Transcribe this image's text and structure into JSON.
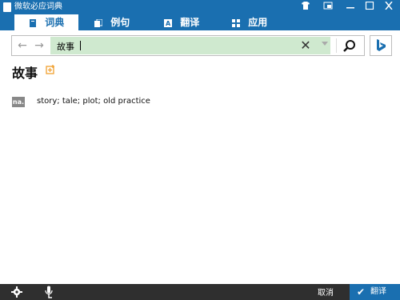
{
  "window": {
    "title": "微软必应词典"
  },
  "tabs": [
    {
      "label": "词典",
      "icon": "book-icon",
      "active": true
    },
    {
      "label": "例句",
      "icon": "pages-icon",
      "active": false
    },
    {
      "label": "翻译",
      "icon": "translate-icon",
      "active": false
    },
    {
      "label": "应用",
      "icon": "apps-grid-icon",
      "active": false
    }
  ],
  "search": {
    "value": "故事"
  },
  "entry": {
    "headword": "故事",
    "pos": "na.",
    "definition": "story; tale; plot; old practice"
  },
  "bottom": {
    "cancel_label": "取消",
    "translate_label": "翻译"
  },
  "colors": {
    "accent": "#1a6fb0",
    "search_fill": "#cfe9cf",
    "bottom_bar": "#2f2f2f",
    "add_icon": "#f0a030"
  }
}
